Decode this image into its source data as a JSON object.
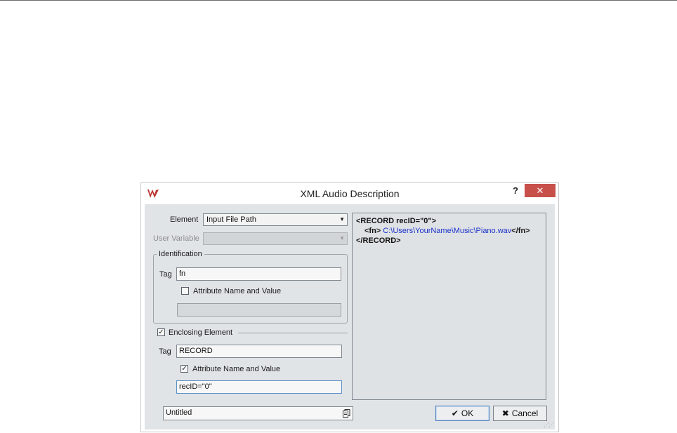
{
  "dialog": {
    "title": "XML Audio Description",
    "help_label": "?",
    "close_label": "✕"
  },
  "form": {
    "element_label": "Element",
    "element_value": "Input File Path",
    "user_variable_label": "User Variable",
    "user_variable_value": "",
    "identification": {
      "title": "Identification",
      "tag_label": "Tag",
      "tag_value": "fn",
      "attribute_label": "Attribute Name and Value",
      "attribute_checked": false,
      "attribute_value": ""
    },
    "enclosing": {
      "label": "Enclosing Element",
      "checked": true,
      "tag_label": "Tag",
      "tag_value": "RECORD",
      "attribute_label": "Attribute Name and Value",
      "attribute_checked": true,
      "attribute_value": "recID=\"0\""
    }
  },
  "preview": {
    "line1": "<RECORD recID=\"0\">",
    "line2_open": "<fn>",
    "line2_value": "C:\\Users\\YourName\\Music\\Piano.wav",
    "line2_close": "</fn>",
    "line3": "</RECORD>"
  },
  "preset": {
    "value": "Untitled"
  },
  "buttons": {
    "ok_label": "OK",
    "cancel_label": "Cancel"
  },
  "icons": {
    "app": "wavelab-logo-icon",
    "preset": "preset-menu-icon",
    "ok": "checkmark-icon",
    "cancel": "x-icon"
  },
  "colors": {
    "close_button": "#c7504b",
    "preview_value": "#1a30c8"
  }
}
